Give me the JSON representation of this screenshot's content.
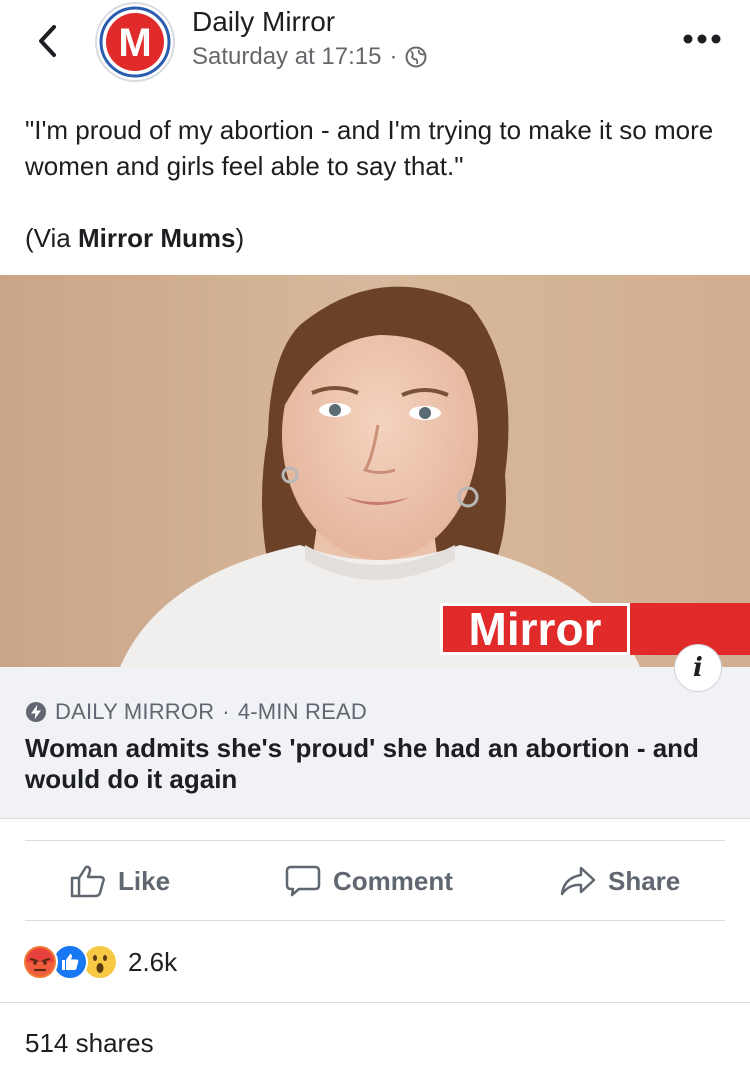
{
  "header": {
    "page_name": "Daily Mirror",
    "timestamp": "Saturday at 17:15",
    "separator": "·",
    "avatar_letter": "M",
    "privacy_icon": "globe-icon"
  },
  "post": {
    "text": "\"I'm proud of my abortion - and I'm trying to make it so more women and girls feel able to say that.\"",
    "via_prefix": "(Via ",
    "via_name": "Mirror Mums",
    "via_suffix": ")"
  },
  "link_preview": {
    "image_logo_text": "Mirror",
    "source": "DAILY MIRROR",
    "separator": "·",
    "read_time": "4-MIN READ",
    "title": "Woman admits she's 'proud' she had an abortion - and would do it again",
    "info_label": "i"
  },
  "actions": {
    "like": "Like",
    "comment": "Comment",
    "share": "Share"
  },
  "reactions": {
    "icons": [
      "angry-icon",
      "like-icon",
      "wow-icon"
    ],
    "count": "2.6k"
  },
  "shares": "514 shares",
  "colors": {
    "brand_red": "#e12b2b",
    "text_primary": "#1c1e21",
    "text_secondary": "#65676b",
    "like_blue": "#1877f2",
    "card_bg": "#f0f2f5"
  }
}
